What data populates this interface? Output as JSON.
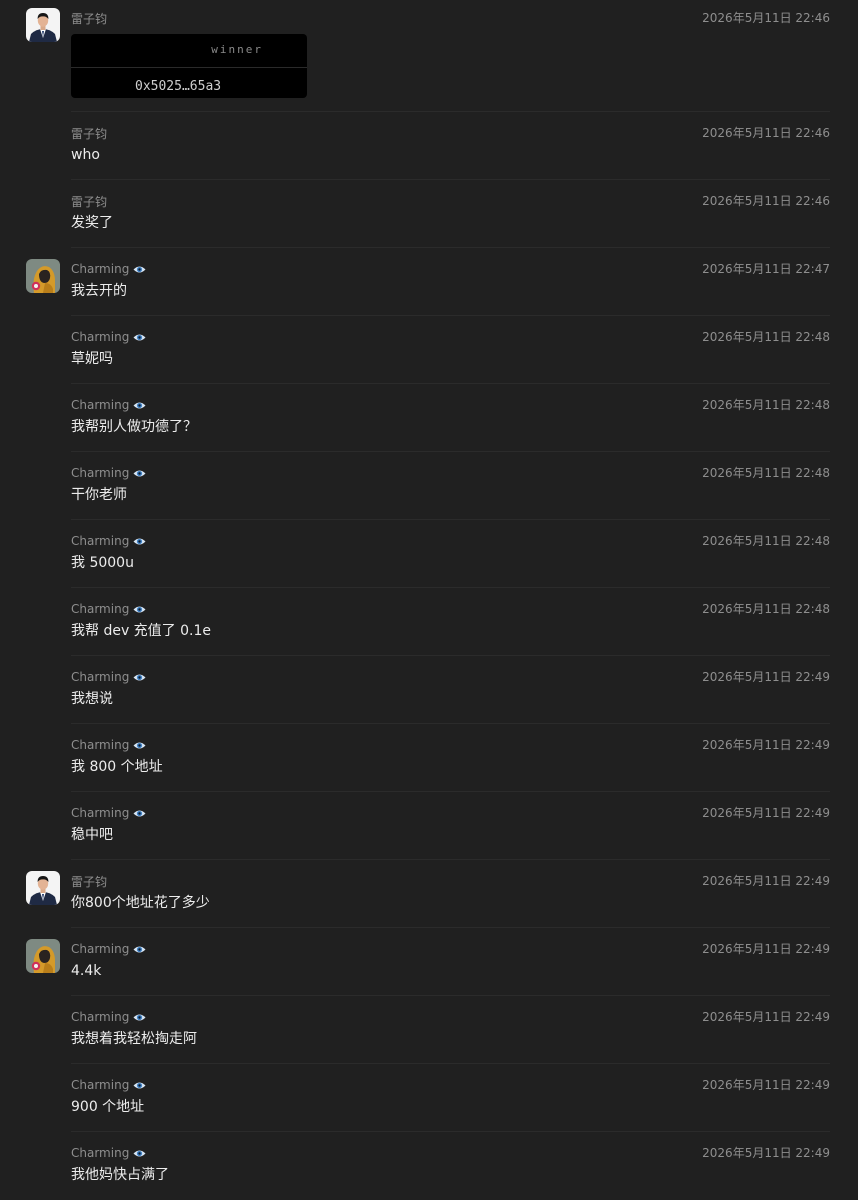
{
  "messages": [
    {
      "author": "雷子钧",
      "time": "2026年5月11日 22:46",
      "text": "",
      "card": {
        "label": "winner",
        "address": "0x5025…65a3"
      }
    },
    {
      "author": "雷子钧",
      "time": "2026年5月11日 22:46",
      "text": "who"
    },
    {
      "author": "雷子钧",
      "time": "2026年5月11日 22:46",
      "text": "发奖了"
    },
    {
      "author": "Charming",
      "time": "2026年5月11日 22:47",
      "text": "我去开的"
    },
    {
      "author": "Charming",
      "time": "2026年5月11日 22:48",
      "text": "草妮吗"
    },
    {
      "author": "Charming",
      "time": "2026年5月11日 22:48",
      "text": "我帮别人做功德了？"
    },
    {
      "author": "Charming",
      "time": "2026年5月11日 22:48",
      "text": "干你老师"
    },
    {
      "author": "Charming",
      "time": "2026年5月11日 22:48",
      "text": "我 5000u"
    },
    {
      "author": "Charming",
      "time": "2026年5月11日 22:48",
      "text": "我帮 dev 充值了 0.1e"
    },
    {
      "author": "Charming",
      "time": "2026年5月11日 22:49",
      "text": "我想说"
    },
    {
      "author": "Charming",
      "time": "2026年5月11日 22:49",
      "text": "我 800 个地址"
    },
    {
      "author": "Charming",
      "time": "2026年5月11日 22:49",
      "text": "稳中吧"
    },
    {
      "author": "雷子钧",
      "time": "2026年5月11日 22:49",
      "text": "你800个地址花了多少"
    },
    {
      "author": "Charming",
      "time": "2026年5月11日 22:49",
      "text": "4.4k"
    },
    {
      "author": "Charming",
      "time": "2026年5月11日 22:49",
      "text": "我想着我轻松掏走阿"
    },
    {
      "author": "Charming",
      "time": "2026年5月11日 22:49",
      "text": "900 个地址"
    },
    {
      "author": "Charming",
      "time": "2026年5月11日 22:49",
      "text": "我他妈快占满了"
    }
  ],
  "colors": {
    "background": "#202020",
    "text": "#ececec",
    "meta": "#8e8e8e",
    "separator": "#2b2b2b"
  }
}
